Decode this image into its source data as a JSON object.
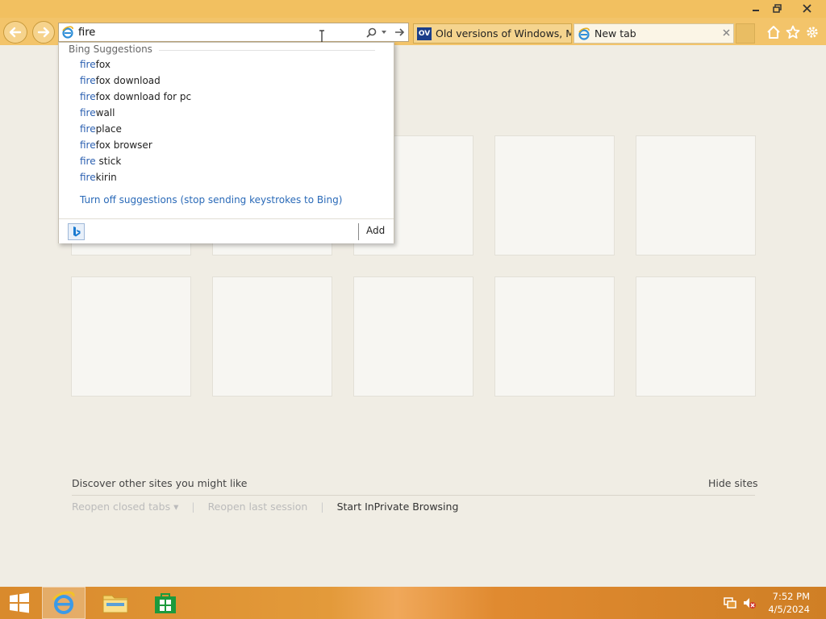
{
  "address_bar": {
    "value": "fire"
  },
  "tabs": [
    {
      "label": "Old versions of Windows, Mac ...",
      "badge": "OV"
    },
    {
      "label": "New tab"
    }
  ],
  "suggestions": {
    "header": "Bing Suggestions",
    "typed": "fire",
    "items": [
      {
        "hl": "fire",
        "rest": "fox"
      },
      {
        "hl": "fire",
        "rest": "fox download"
      },
      {
        "hl": "fire",
        "rest": "fox download for pc"
      },
      {
        "hl": "fire",
        "rest": "wall"
      },
      {
        "hl": "fire",
        "rest": "place"
      },
      {
        "hl": "fire",
        "rest": "fox browser"
      },
      {
        "hl": "fire",
        "rest": " stick"
      },
      {
        "hl": "fire",
        "rest": "kirin"
      }
    ],
    "turn_off": "Turn off suggestions (stop sending keystrokes to Bing)",
    "add": "Add"
  },
  "discover": {
    "title": "Discover other sites you might like",
    "hide": "Hide sites",
    "reopen_closed": "Reopen closed tabs ▾",
    "sep": "|",
    "reopen_last": "Reopen last session",
    "inprivate": "Start InPrivate Browsing"
  },
  "clock": {
    "time": "7:52 PM",
    "date": "4/5/2024"
  },
  "icons": {
    "back": "back-arrow-icon",
    "forward": "forward-arrow-icon",
    "search": "search-icon",
    "go": "go-arrow-icon",
    "home": "home-icon",
    "favorites": "star-icon",
    "settings": "gear-icon"
  },
  "colors": {
    "chrome": "#f3c46a",
    "highlight": "#2a5fb0",
    "link": "#2a6ab8",
    "taskbar": "#d98a2c"
  }
}
